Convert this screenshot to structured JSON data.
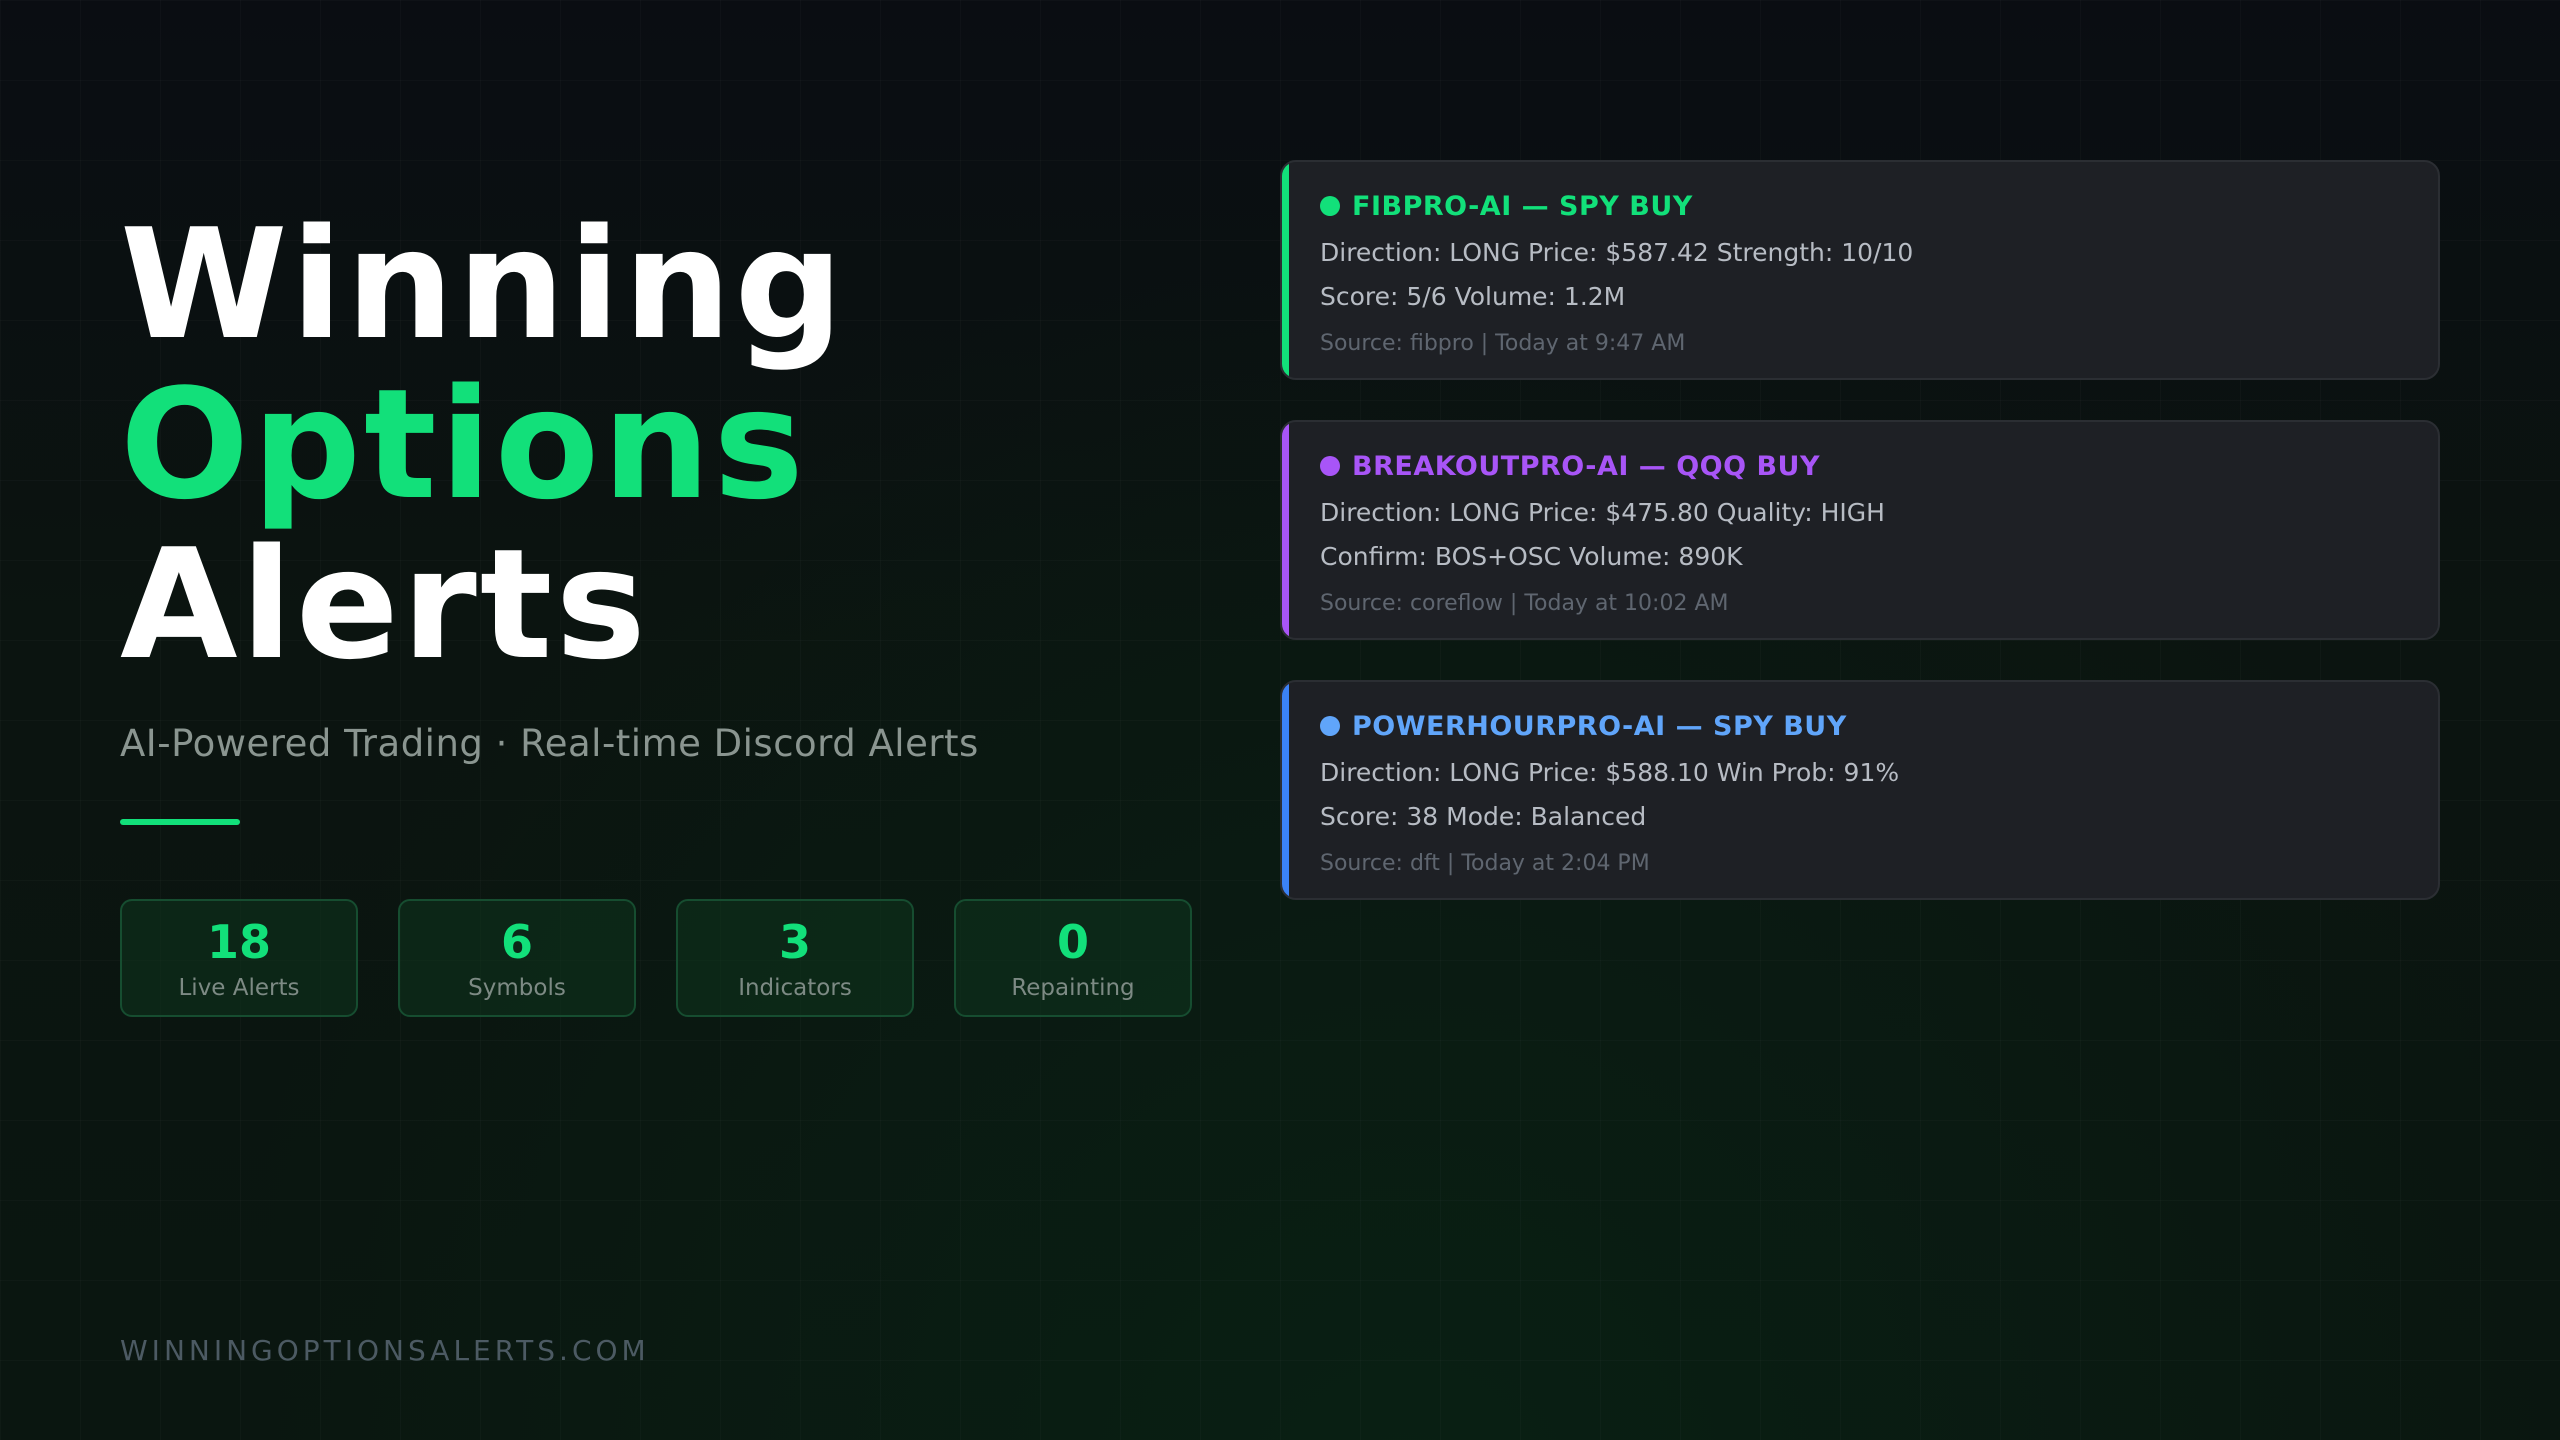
{
  "hero": {
    "title_line1": "Winning",
    "title_line2": "Options",
    "title_line3": "Alerts",
    "subtitle": "AI-Powered Trading · Real-time Discord Alerts"
  },
  "stats": [
    {
      "value": "18",
      "label": "Live Alerts"
    },
    {
      "value": "6",
      "label": "Symbols"
    },
    {
      "value": "3",
      "label": "Indicators"
    },
    {
      "value": "0",
      "label": "Repainting"
    }
  ],
  "footer": {
    "url": "WINNINGOPTIONSALERTS.COM"
  },
  "alerts": [
    {
      "title": "FIBPRO-AI — SPY BUY",
      "color": "#12e07a",
      "line1": "Direction: LONG Price: $587.42 Strength: 10/10",
      "line2": "Score: 5/6 Volume: 1.2M",
      "source": "Source: fibpro | Today at 9:47 AM"
    },
    {
      "title": "BREAKOUTPRO-AI — QQQ BUY",
      "color": "#a855f7",
      "line1": "Direction: LONG Price: $475.80 Quality: HIGH",
      "line2": "Confirm: BOS+OSC Volume: 890K",
      "source": "Source: coreflow | Today at 10:02 AM"
    },
    {
      "title": "POWERHOURPRO-AI — SPY BUY",
      "color": "#60a5fa",
      "line1": "Direction: LONG Price: $588.10 Win Prob: 91%",
      "line2": "Score: 38 Mode: Balanced",
      "source": "Source: dft | Today at 2:04 PM"
    }
  ],
  "colors": {
    "accent": "#12e07a",
    "stripe_blue": "#3b82f6"
  }
}
